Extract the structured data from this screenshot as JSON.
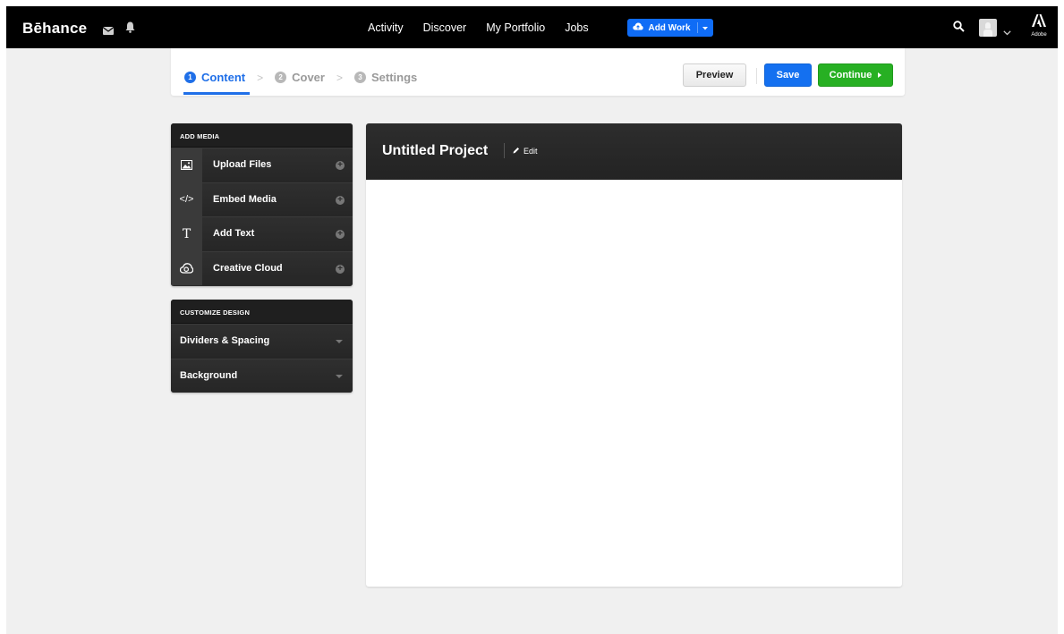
{
  "brand": {
    "logo": "Bēhance"
  },
  "topnav": {
    "links": [
      "Activity",
      "Discover",
      "My Portfolio",
      "Jobs"
    ],
    "add_work_label": "Add Work",
    "adobe_label": "Adobe"
  },
  "icons": {
    "mail": "mail-icon",
    "bell": "bell-icon",
    "search": "search-icon",
    "cloud": "cloud-upload-icon"
  },
  "steps": [
    {
      "num": "1",
      "label": "Content",
      "active": true
    },
    {
      "num": "2",
      "label": "Cover",
      "active": false
    },
    {
      "num": "3",
      "label": "Settings",
      "active": false
    }
  ],
  "actions": {
    "preview_label": "Preview",
    "save_label": "Save",
    "continue_label": "Continue"
  },
  "add_media": {
    "heading": "ADD MEDIA",
    "items": [
      {
        "label": "Upload Files",
        "icon": "image-icon"
      },
      {
        "label": "Embed Media",
        "icon": "code-icon"
      },
      {
        "label": "Add Text",
        "icon": "text-icon"
      },
      {
        "label": "Creative Cloud",
        "icon": "creative-cloud-icon"
      }
    ]
  },
  "customize_design": {
    "heading": "CUSTOMIZE DESIGN",
    "items": [
      {
        "label": "Dividers & Spacing"
      },
      {
        "label": "Background"
      }
    ]
  },
  "project": {
    "title": "Untitled Project",
    "edit_label": "Edit"
  },
  "colors": {
    "topbar": "#000000",
    "page_bg": "#f0f0f0",
    "primary_blue": "#1f6fe8",
    "save_blue": "#1470f0",
    "continue_green": "#27b023",
    "panel_dark": "#2b2b2b"
  }
}
